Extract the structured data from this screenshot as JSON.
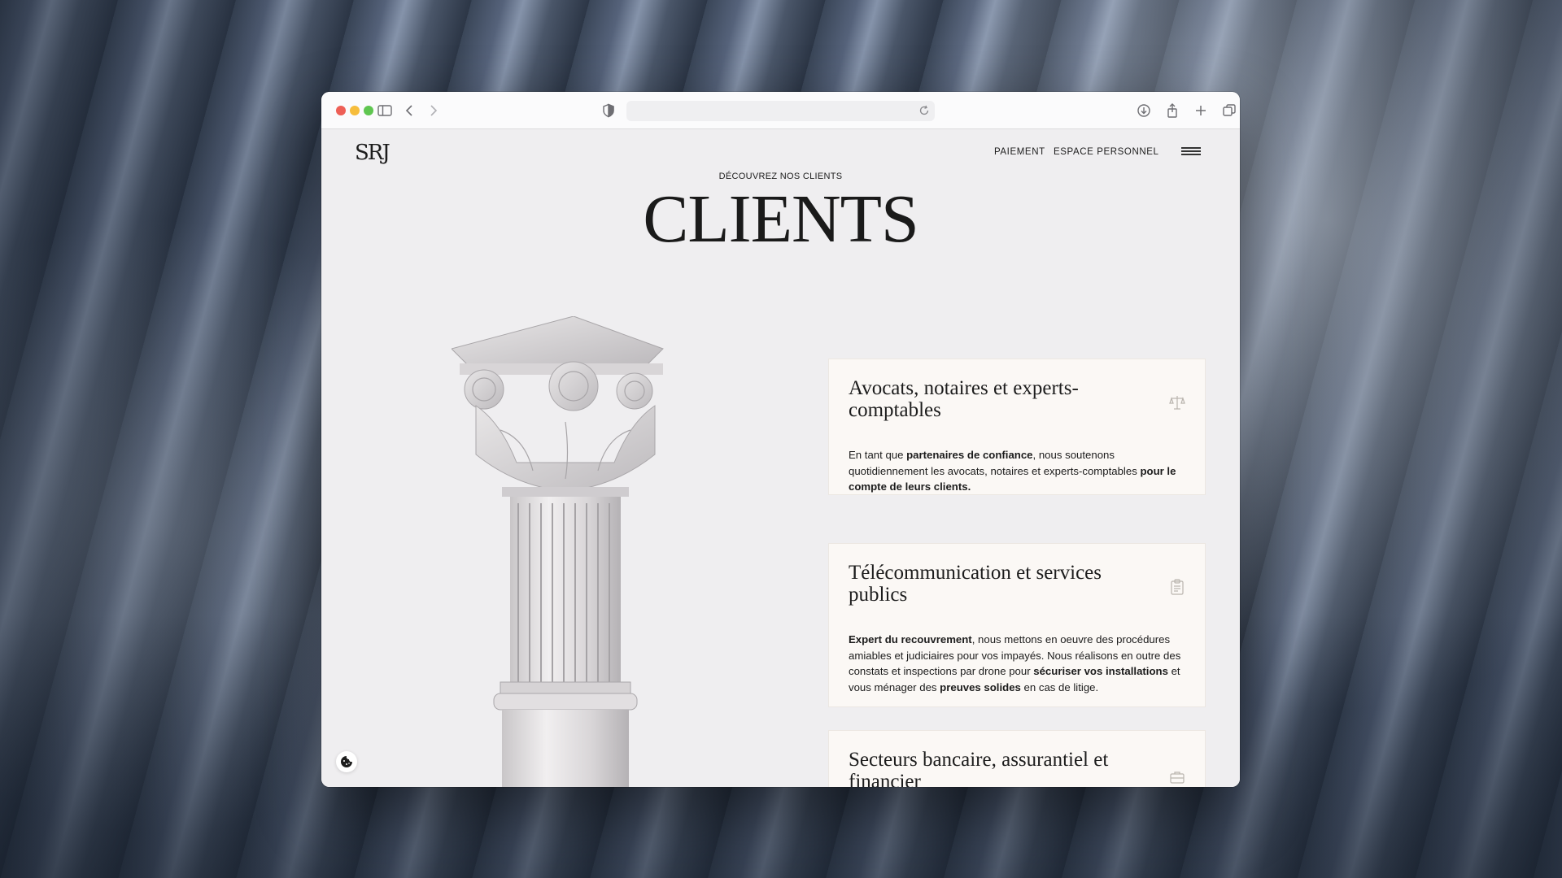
{
  "browser": {
    "address_text": ""
  },
  "site": {
    "logo": "SRJ",
    "nav": {
      "payment": "PAIEMENT",
      "personal_space": "ESPACE PERSONNEL"
    }
  },
  "hero": {
    "eyebrow": "DÉCOUVREZ NOS CLIENTS",
    "title": "CLIENTS"
  },
  "cards": [
    {
      "title": "Avocats, notaires et experts-comptables",
      "icon": "scales-icon",
      "body": [
        {
          "text": "En tant que ",
          "bold": false
        },
        {
          "text": "partenaires de confiance",
          "bold": true
        },
        {
          "text": ", nous soutenons quotidiennement les avocats, notaires et experts-comptables ",
          "bold": false
        },
        {
          "text": "pour le compte de leurs clients.",
          "bold": true
        }
      ]
    },
    {
      "title": "Télécommunication et services publics",
      "icon": "clipboard-icon",
      "body": [
        {
          "text": "Expert du recouvrement",
          "bold": true
        },
        {
          "text": ", nous mettons en oeuvre des procédures amiables et judiciaires pour vos impayés. Nous réalisons en outre des constats et inspections par drone pour ",
          "bold": false
        },
        {
          "text": "sécuriser vos installations",
          "bold": true
        },
        {
          "text": " et vous ménager des ",
          "bold": false
        },
        {
          "text": "preuves solides",
          "bold": true
        },
        {
          "text": " en cas de litige.",
          "bold": false
        }
      ]
    },
    {
      "title": "Secteurs bancaire, assurantiel et financier",
      "icon": "briefcase-icon",
      "body": []
    }
  ],
  "colors": {
    "page_bg": "#efeef0",
    "card_bg": "#fbf8f5",
    "text": "#1c1c1c",
    "icon_muted": "#b9b4ae"
  }
}
